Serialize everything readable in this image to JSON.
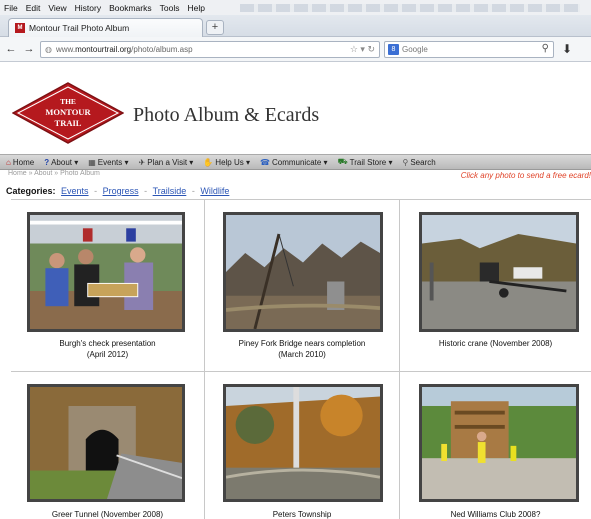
{
  "browser": {
    "menu": [
      "File",
      "Edit",
      "View",
      "History",
      "Bookmarks",
      "Tools",
      "Help"
    ],
    "tab_title": "Montour Trail Photo Album",
    "new_tab_label": "+",
    "url_prefix": "www.",
    "url_domain": "montourtrail.org",
    "url_path": "/photo/album.asp",
    "search_placeholder": "Google"
  },
  "site": {
    "logo_lines": [
      "THE",
      "MONTOUR",
      "TRAIL"
    ],
    "title": "Photo Album & Ecards",
    "nav": [
      {
        "icon": "home-icon",
        "glyph": "⌂",
        "label": "Home"
      },
      {
        "icon": "question-icon",
        "glyph": "?",
        "label": "About ▾"
      },
      {
        "icon": "calendar-icon",
        "glyph": "▦",
        "label": "Events ▾"
      },
      {
        "icon": "hiker-icon",
        "glyph": "✈",
        "label": "Plan a Visit ▾"
      },
      {
        "icon": "help-icon",
        "glyph": "✋",
        "label": "Help Us ▾"
      },
      {
        "icon": "people-icon",
        "glyph": "☎",
        "label": "Communicate ▾"
      },
      {
        "icon": "store-icon",
        "glyph": "⛟",
        "label": "Trail Store ▾"
      },
      {
        "icon": "search-icon",
        "glyph": "⚲",
        "label": "Search"
      }
    ],
    "breadcrumb": "Home » About » Photo Album",
    "hint": "Click any photo to send a free ecard!",
    "categories_label": "Categories:",
    "categories": [
      "Events",
      "Progress",
      "Trailside",
      "Wildlife"
    ]
  },
  "photos": [
    {
      "caption_1": "Burgh's check presentation",
      "caption_2": "(April 2012)"
    },
    {
      "caption_1": "Piney Fork Bridge nears completion",
      "caption_2": "(March 2010)"
    },
    {
      "caption_1": "Historic crane (November 2008)",
      "caption_2": ""
    },
    {
      "caption_1": "Greer Tunnel (November 2008)",
      "caption_2": ""
    },
    {
      "caption_1": "Peters Township",
      "caption_2": ""
    },
    {
      "caption_1": "Ned Williams Club 2008?",
      "caption_2": ""
    }
  ]
}
